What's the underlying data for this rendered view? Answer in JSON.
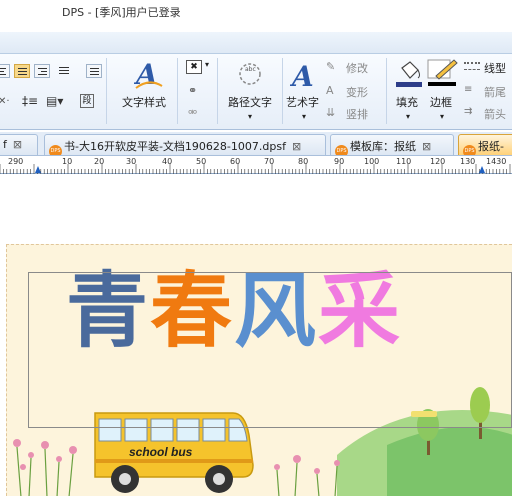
{
  "window": {
    "title": "DPS - [季风]用户已登录"
  },
  "ribbon": {
    "text_style_label": "文字样式",
    "path_text_label": "路径文字",
    "art_text_label": "艺术字",
    "modify_label": "修改",
    "transform_label": "变形",
    "vertical_label": "竖排",
    "fill_label": "填充",
    "border_label": "边框",
    "line_type_label": "线型",
    "arrow_tail_label": "箭尾",
    "arrow_head_label": "箭头"
  },
  "tabs": [
    {
      "label": "f",
      "close": "⊠",
      "active": false
    },
    {
      "label": "书-大16开软皮平装-文档190628-1007.dpsf",
      "close": "⊠",
      "active": false
    },
    {
      "label": "模板库：报纸",
      "close": "⊠",
      "active": false
    },
    {
      "label": "报纸-",
      "close": "",
      "active": true
    }
  ],
  "ruler": {
    "ticks": [
      "290",
      "10",
      "20",
      "30",
      "40",
      "50",
      "60",
      "70",
      "80",
      "90",
      "100",
      "110",
      "120",
      "130",
      "1430"
    ]
  },
  "poster": {
    "title_chars": [
      {
        "char": "青",
        "color": "#4a6a9c"
      },
      {
        "char": "春",
        "color": "#f07a10"
      },
      {
        "char": "风",
        "color": "#5a8fcf"
      },
      {
        "char": "采",
        "color": "#f07ae0"
      }
    ],
    "bus_label": "school bus"
  },
  "colors": {
    "accent": "#d9a43a",
    "ribbon_bg": "#e6eef8",
    "dps_orange": "#f08a1c"
  }
}
